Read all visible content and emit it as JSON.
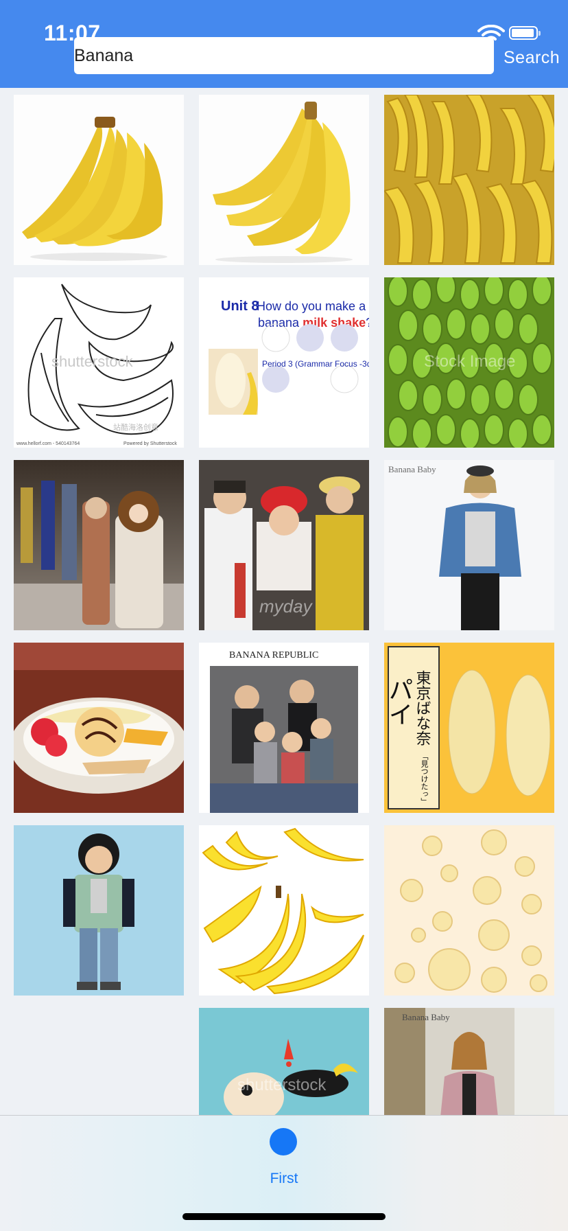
{
  "status_bar": {
    "time": "11:07"
  },
  "search": {
    "value": "Banana",
    "button_label": "Search"
  },
  "results": [
    {
      "name": "banana-bunch-image"
    },
    {
      "name": "banana-bunch-image"
    },
    {
      "name": "banana-pile-image"
    },
    {
      "name": "banana-sketch-image",
      "watermark": "shutterstock",
      "footer_left": "www.hellorf.com - 540143764",
      "footer_right": "Powered by Shutterstock",
      "cn_text": "站酷海洛创意"
    },
    {
      "name": "milkshake-lesson-image",
      "unit": "Unit 8",
      "line1": "How do you make  a",
      "line2a": "banana ",
      "line2b": "milk shake",
      "line2c": "?",
      "line3": "Period 3 (Grammar Focus -3d)"
    },
    {
      "name": "green-bananas-image",
      "watermark": "Stock Image"
    },
    {
      "name": "runway-fashion-image"
    },
    {
      "name": "fashion-group-image",
      "watermark": "myday"
    },
    {
      "name": "denim-jacket-model-image",
      "brand": "Banana Baby"
    },
    {
      "name": "banana-split-image"
    },
    {
      "name": "banana-republic-family-image",
      "brand": "BANANA REPUBLIC"
    },
    {
      "name": "tokyo-banana-cake-image",
      "jp": "東京ばな奈",
      "jp2": "パイ",
      "jp3": "「見つけたっ」"
    },
    {
      "name": "boy-in-jacket-image"
    },
    {
      "name": "cartoon-bananas-image"
    },
    {
      "name": "banana-slices-image"
    },
    {
      "name": "slipping-cartoon-image",
      "watermark": "shutterstock"
    },
    {
      "name": "pink-coat-model-image",
      "brand": "Banana Baby"
    }
  ],
  "tab_bar": {
    "items": [
      {
        "label": "First",
        "icon": "circle-icon",
        "active": true
      }
    ]
  },
  "colors": {
    "header": "#4589ee",
    "accent": "#1677f6",
    "background": "#eef1f5"
  }
}
